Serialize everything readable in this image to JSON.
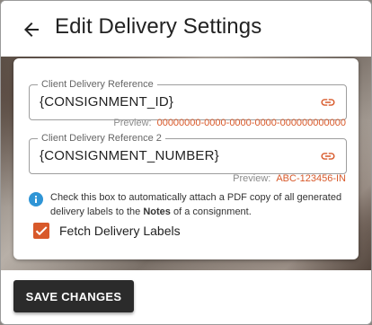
{
  "header": {
    "title": "Edit Delivery Settings",
    "back_icon": "arrow-left-icon"
  },
  "fields": [
    {
      "label": "Client Delivery Reference",
      "value": "{CONSIGNMENT_ID}",
      "icon": "link-icon",
      "preview_label": "Preview:",
      "preview_value": "00000000-0000-0000-0000-000000000000"
    },
    {
      "label": "Client Delivery Reference 2",
      "value": "{CONSIGNMENT_NUMBER}",
      "icon": "link-icon",
      "preview_label": "Preview:",
      "preview_value": "ABC-123456-IN"
    }
  ],
  "info": {
    "icon": "info-icon",
    "text_before": "Check this box to automatically attach a PDF copy of all generated delivery labels to the ",
    "text_bold": "Notes",
    "text_after": " of a consignment."
  },
  "checkbox": {
    "label": "Fetch Delivery Labels",
    "checked": true
  },
  "footer": {
    "save_label": "SAVE CHANGES"
  },
  "colors": {
    "accent": "#d8592a",
    "info_blue": "#2f95d6",
    "button_bg": "#2b2b2b"
  }
}
